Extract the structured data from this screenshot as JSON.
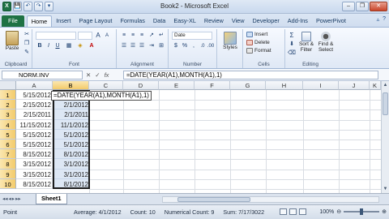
{
  "window": {
    "title": "Book2 - Microsoft Excel",
    "qat": [
      "X",
      "💾",
      "↶",
      "↷",
      "▾"
    ],
    "controls": [
      "–",
      "❐",
      "✕"
    ]
  },
  "tabs": [
    {
      "label": "File"
    },
    {
      "label": "Home"
    },
    {
      "label": "Insert"
    },
    {
      "label": "Page Layout"
    },
    {
      "label": "Formulas"
    },
    {
      "label": "Data"
    },
    {
      "label": "Easy-XL"
    },
    {
      "label": "Review"
    },
    {
      "label": "View"
    },
    {
      "label": "Developer"
    },
    {
      "label": "Add-Ins"
    },
    {
      "label": "PowerPivot"
    }
  ],
  "ribbon": {
    "groups": {
      "clipboard": "Clipboard",
      "font": "Font",
      "alignment": "Alignment",
      "number": "Number",
      "cells": "Cells",
      "editing": "Editing"
    },
    "paste": "Paste",
    "number_format": "Date",
    "styles": "Styles",
    "insert": "Insert",
    "delete": "Delete",
    "format": "Format",
    "sort_filter": "Sort & Filter",
    "find_select": "Find & Select"
  },
  "formula_bar": {
    "name_box": "NORM.INV",
    "cancel": "✕",
    "enter": "✓",
    "fx": "fx",
    "formula": "=DATE(YEAR(A1),MONTH(A1),1)"
  },
  "grid": {
    "columns": [
      "A",
      "B",
      "C",
      "D",
      "E",
      "F",
      "G",
      "H",
      "I",
      "J",
      "K"
    ],
    "rows": [
      "1",
      "2",
      "3",
      "4",
      "5",
      "6",
      "7",
      "8",
      "9",
      "10"
    ],
    "col_a": [
      "5/15/2012",
      "2/15/2012",
      "2/15/2011",
      "11/15/2012",
      "5/15/2012",
      "5/15/2012",
      "8/15/2012",
      "3/15/2012",
      "3/15/2012",
      "8/15/2012"
    ],
    "col_b": [
      "",
      "2/1/2012",
      "2/1/2011",
      "11/1/2012",
      "5/1/2012",
      "5/1/2012",
      "8/1/2012",
      "3/1/2012",
      "3/1/2012",
      "8/1/2012"
    ],
    "editing_text": "=DATE(YEAR(A1),MONTH(A1),1)"
  },
  "sheet_tabs": {
    "active": "Sheet1",
    "nav": [
      "◂◂",
      "◂",
      "▸",
      "▸▸"
    ]
  },
  "status": {
    "mode": "Point",
    "average": "Average: 4/1/2012",
    "count": "Count: 10",
    "numerical_count": "Numerical Count: 9",
    "sum": "Sum: 7/17/3022",
    "zoom": "100%"
  }
}
